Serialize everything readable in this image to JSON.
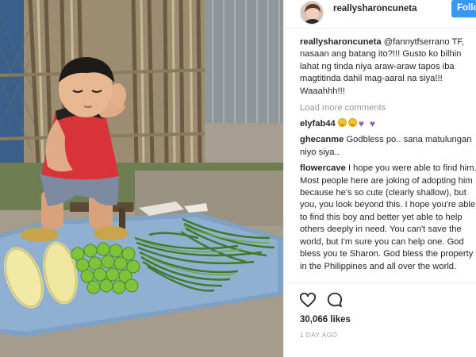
{
  "post": {
    "username": "reallysharoncuneta",
    "follow_label": "Follo",
    "likes": "30,066 likes",
    "time": "1 DAY AGO"
  },
  "caption": {
    "user": "reallysharoncuneta",
    "text": " @fannytfserrano TF, nasaan ang batang ito?!!! Gusto ko bilhin lahat ng tinda niya araw-araw tapos iba magtitinda dahil mag-aaral na siya!!! Waaahhh!!!"
  },
  "load_more": "Load more comments",
  "comments": [
    {
      "user": "elyfab44",
      "text": "",
      "emoji": [
        "smile",
        "smile",
        "purple-heart",
        "purple-heart"
      ]
    },
    {
      "user": "ghecanme",
      "text": " Godbless po.. sana matulungan niyo siya.."
    },
    {
      "user": "flowercave",
      "text": " I hope you were able to find him. Most people here are joking of adopting him because he's so cute (clearly shallow), but you, you look beyond this. I hope you're able to find this boy and better yet able to help others deeply in need. You can't save the world, but I'm sure you can help one. God bless you te Sharon. God bless the property in the Philippines and all over the world."
    }
  ],
  "icons": {
    "like": "heart-outline-icon",
    "comment": "speech-bubble-icon",
    "smile": "smiling-face-emoji",
    "heart": "purple-heart-emoji"
  },
  "colors": {
    "follow": "#3897f0",
    "muted": "#999999",
    "heart_purple": "#8e5bd1"
  }
}
